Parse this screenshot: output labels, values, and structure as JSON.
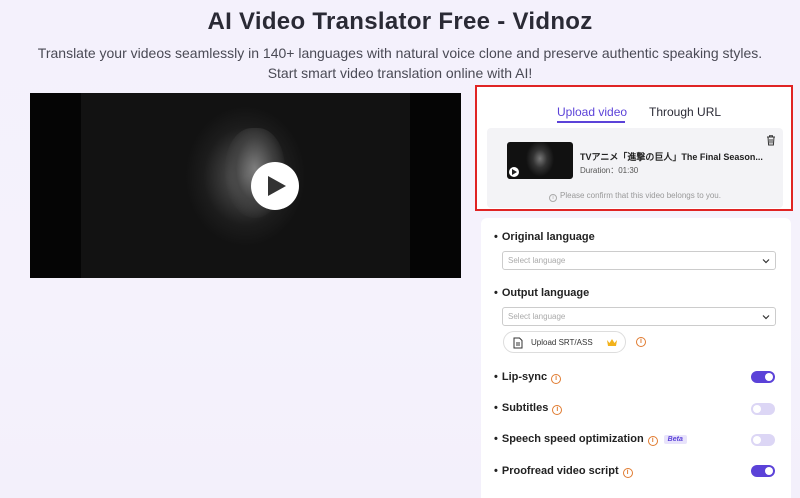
{
  "header": {
    "title": "AI Video Translator Free - Vidnoz",
    "subtitle_line1": "Translate your videos seamlessly in 140+ languages with natural voice clone and preserve authentic speaking styles.",
    "subtitle_line2": "Start smart video translation online with AI!"
  },
  "upload": {
    "tabs": [
      {
        "label": "Upload video",
        "active": true
      },
      {
        "label": "Through URL",
        "active": false
      }
    ],
    "file": {
      "name": "TVアニメ「進撃の巨人」The Final Season...",
      "duration": "Duration：01:30"
    },
    "confirm_text": "Please confirm that this video belongs to you."
  },
  "settings": {
    "original_language": {
      "label": "Original language",
      "placeholder": "Select language"
    },
    "output_language": {
      "label": "Output language",
      "placeholder": "Select language"
    },
    "upload_srt_label": "Upload SRT/ASS",
    "toggles": [
      {
        "label": "Lip-sync",
        "on": true,
        "beta": ""
      },
      {
        "label": "Subtitles",
        "on": false,
        "beta": ""
      },
      {
        "label": "Speech speed optimization",
        "on": false,
        "beta": "Beta"
      },
      {
        "label": "Proofread video script",
        "on": true,
        "beta": ""
      }
    ]
  },
  "colors": {
    "accent": "#5b42d8",
    "highlight_border": "#e02424",
    "info_orange": "#e07b30"
  }
}
